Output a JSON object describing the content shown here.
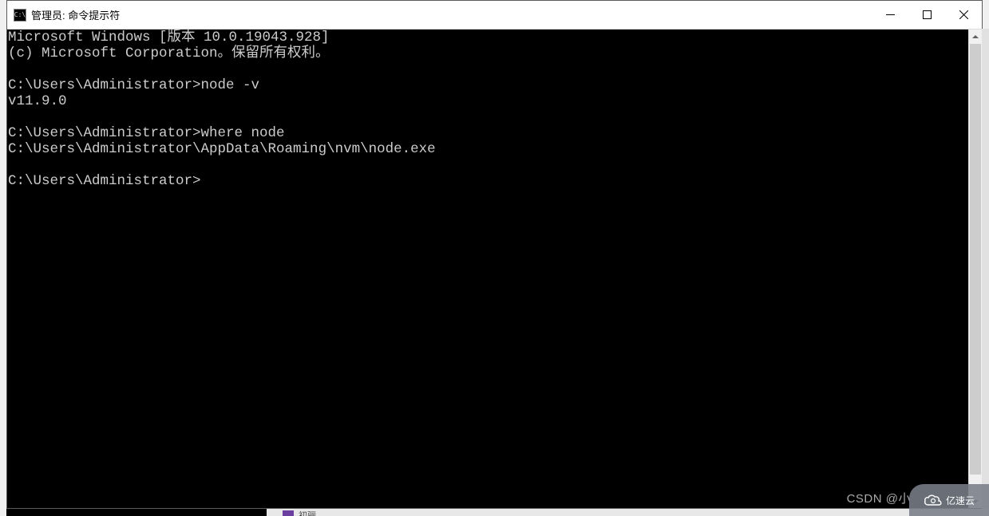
{
  "window": {
    "title": "管理员: 命令提示符",
    "icon_label": "C:\\"
  },
  "terminal": {
    "lines": [
      "Microsoft Windows [版本 10.0.19043.928]",
      "(c) Microsoft Corporation。保留所有权利。",
      "",
      "C:\\Users\\Administrator>node -v",
      "v11.9.0",
      "",
      "C:\\Users\\Administrator>where node",
      "C:\\Users\\Administrator\\AppData\\Roaming\\nvm\\node.exe",
      "",
      "C:\\Users\\Administrator>"
    ]
  },
  "taskbar_fragment_label": "初骊",
  "watermark": {
    "csdn": "CSDN @小",
    "yisu": "亿速云"
  }
}
